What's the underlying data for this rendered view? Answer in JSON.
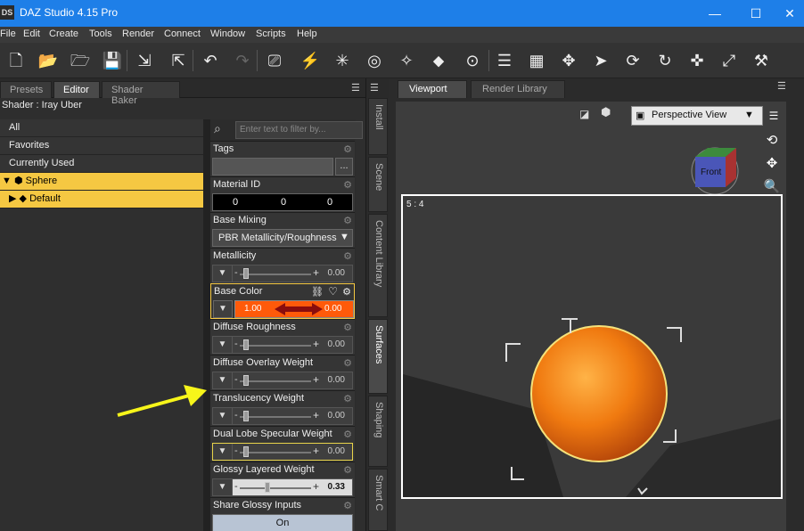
{
  "window": {
    "app_icon": "DS",
    "title": "DAZ Studio 4.15 Pro",
    "minimize": "—",
    "maximize": "☐",
    "close": "✕"
  },
  "menu": [
    "File",
    "Edit",
    "Create",
    "Tools",
    "Render",
    "Connect",
    "Window",
    "Scripts",
    "Help"
  ],
  "left_tabs": [
    "Presets",
    "Editor",
    "Shader Baker"
  ],
  "shader_label": "Shader : Iray Uber",
  "tree": {
    "items": [
      "All",
      "Favorites",
      "Currently Used"
    ],
    "sphere": "Sphere",
    "default": "Default"
  },
  "filter_placeholder": "Enter text to filter by...",
  "props": {
    "tags": {
      "label": "Tags",
      "button": "..."
    },
    "material_id": {
      "label": "Material ID",
      "values": [
        "0",
        "0",
        "0"
      ]
    },
    "base_mixing": {
      "label": "Base Mixing",
      "value": "PBR Metallicity/Roughness"
    },
    "metallicity": {
      "label": "Metallicity",
      "value": "0.00",
      "level": 0
    },
    "base_color": {
      "label": "Base Color",
      "left": "1.00",
      "right": "0.00",
      "color": "#ff5a0a"
    },
    "diffuse_roughness": {
      "label": "Diffuse Roughness",
      "value": "0.00",
      "level": 0
    },
    "diffuse_overlay_weight": {
      "label": "Diffuse Overlay Weight",
      "value": "0.00",
      "level": 0
    },
    "translucency_weight": {
      "label": "Translucency Weight",
      "value": "0.00",
      "level": 0
    },
    "dual_lobe": {
      "label": "Dual Lobe Specular Weight",
      "value": "0.00",
      "level": 0
    },
    "glossy_layered": {
      "label": "Glossy Layered Weight",
      "value": "0.33",
      "level": 0.33
    },
    "share_glossy": {
      "label": "Share Glossy Inputs",
      "value": "On"
    }
  },
  "vertical_tabs": [
    "Install",
    "Scene",
    "Content Library",
    "Surfaces",
    "Shaping",
    "Smart C"
  ],
  "view_tabs": [
    "Viewport",
    "Render Library"
  ],
  "viewport": {
    "camera": "Perspective View",
    "ratio": "5 : 4",
    "cube_label": "Front"
  },
  "colors": {
    "accent": "#f5c842",
    "titlebar": "#1e7fe8",
    "sphere": "#f07a10",
    "annotation_arrow": "#f7f51a"
  },
  "toolbar_icons": [
    "new-file-icon",
    "open-file-icon",
    "save-icon",
    "import-icon",
    "export-icon",
    "undo-icon",
    "redo-icon",
    "camera-icon",
    "light-icon",
    "spotlight-icon",
    "render-icon",
    "lasso-icon",
    "node-icon",
    "align-icon",
    "grid-icon",
    "universal-tool-icon",
    "select-icon",
    "orbit-icon",
    "rotate-icon",
    "translate-icon",
    "scale-icon",
    "joint-icon"
  ]
}
